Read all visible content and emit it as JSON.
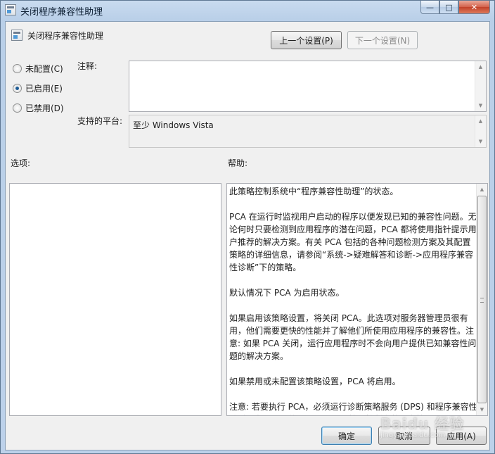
{
  "window": {
    "title": "关闭程序兼容性助理",
    "controls": {
      "minimize": "—",
      "maximize": "□",
      "close": "✕"
    }
  },
  "header": {
    "policy_title": "关闭程序兼容性助理",
    "prev_button": "上一个设置(P)",
    "next_button": "下一个设置(N)"
  },
  "state": {
    "options": [
      {
        "label": "未配置(C)",
        "checked": false
      },
      {
        "label": "已启用(E)",
        "checked": true
      },
      {
        "label": "已禁用(D)",
        "checked": false
      }
    ]
  },
  "comment": {
    "label": "注释:",
    "value": ""
  },
  "platform": {
    "label": "支持的平台:",
    "value": "至少 Windows Vista"
  },
  "options_section": {
    "label": "选项:"
  },
  "help_section": {
    "label": "帮助:",
    "paragraphs": [
      "此策略控制系统中“程序兼容性助理”的状态。",
      "PCA 在运行时监视用户启动的程序以便发现已知的兼容性问题。无论何时只要检测到应用程序的潜在问题，PCA 都将使用指针提示用户推荐的解决方案。有关 PCA 包括的各种问题检测方案及其配置策略的详细信息，请参阅“系统->疑难解答和诊断->应用程序兼容性诊断”下的策略。",
      "默认情况下 PCA 为启用状态。",
      "如果启用该策略设置，将关闭 PCA。此选项对服务器管理员很有用，他们需要更快的性能并了解他们所使用应用程序的兼容性。注意: 如果 PCA 关闭，运行应用程序时不会向用户提供已知兼容性问题的解决方案。",
      "如果禁用或未配置该策略设置，PCA 将启用。",
      "注意: 若要执行 PCA，必须运行诊断策略服务 (DPS) 和程序兼容性助手服务。可以使用 Microsoft 管理控制台的服务管理单元配置"
    ]
  },
  "footer": {
    "ok_button": "确定",
    "cancel_button": "取消",
    "apply_button": "应用(A)"
  },
  "watermark": {
    "text": "Baidu 经验",
    "sub": "jingyan.baidu.com"
  }
}
